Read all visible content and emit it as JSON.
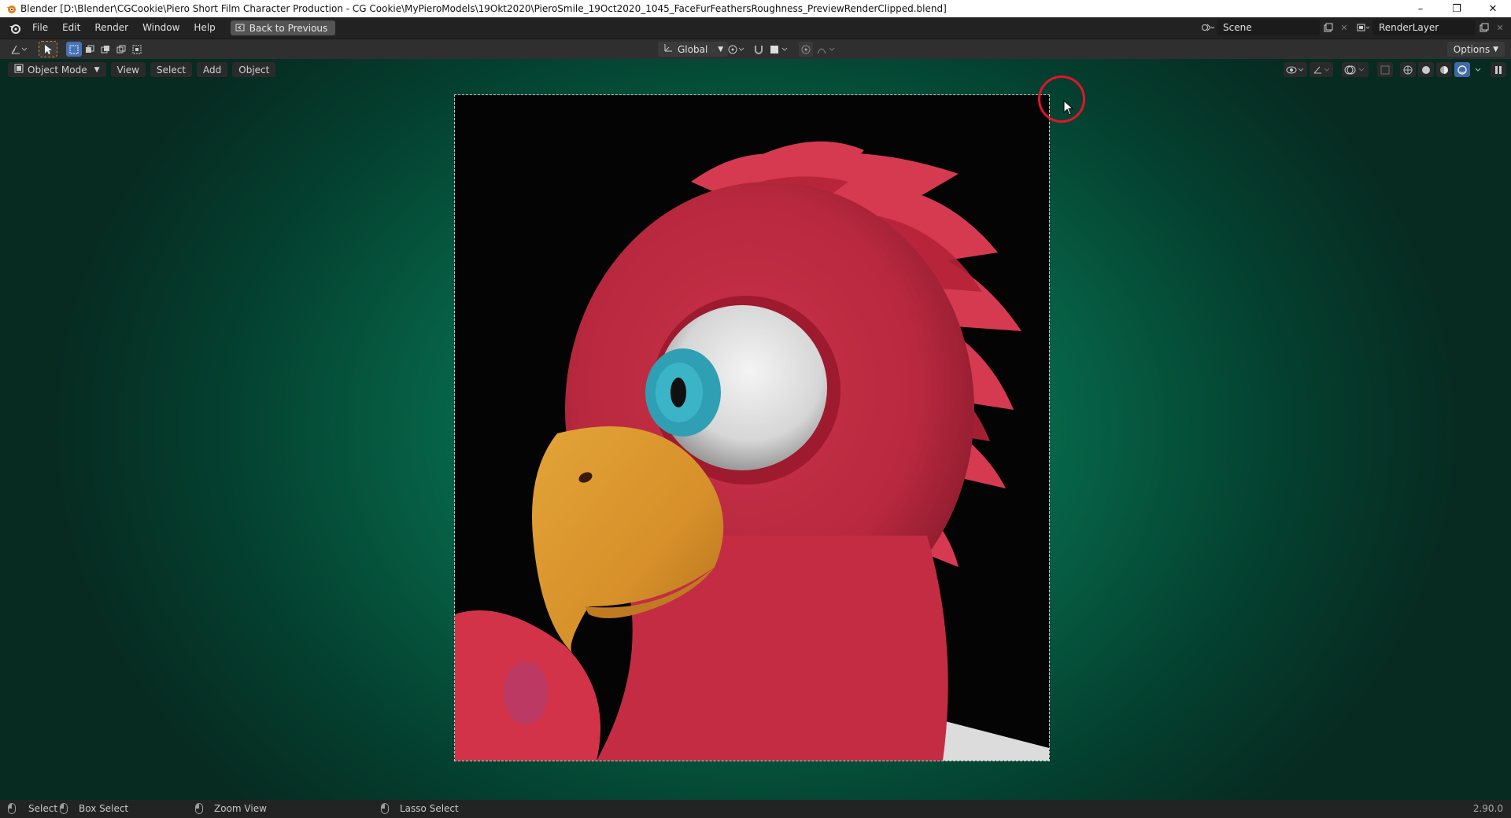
{
  "window": {
    "title": "Blender [D:\\Blender\\CGCookie\\Piero Short Film Character Production - CG Cookie\\MyPieroModels\\19Okt2020\\PieroSmile_19Oct2020_1045_FaceFurFeathersRoughness_PreviewRenderClipped.blend]",
    "minimize": "–",
    "restore": "❐",
    "close": "✕"
  },
  "menubar": {
    "items": [
      "File",
      "Edit",
      "Render",
      "Window",
      "Help"
    ],
    "back_label": "Back to Previous",
    "scene_value": "Scene",
    "render_layer_value": "RenderLayer"
  },
  "toolheader": {
    "orientation": "Global",
    "options_label": "Options"
  },
  "viewport": {
    "mode": "Object Mode",
    "menus": [
      "View",
      "Select",
      "Add",
      "Object"
    ]
  },
  "statusbar": {
    "select": "Select",
    "box_select": "Box Select",
    "zoom_view": "Zoom View",
    "lasso_select": "Lasso Select",
    "version": "2.90.0"
  },
  "colors": {
    "accent": "#4772b3",
    "viewport_bg": "#087754",
    "parrot_red": "#d22d3c",
    "beak": "#e8a82c",
    "iris": "#2fa5b8"
  }
}
